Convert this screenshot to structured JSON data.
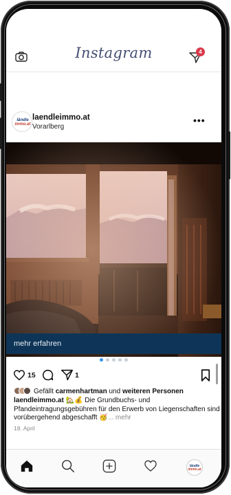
{
  "header": {
    "logo": "Instagram",
    "camera_icon": "camera-icon",
    "direct_icon": "direct-message-icon",
    "direct_badge": "4"
  },
  "post": {
    "username": "laendleimmo.at",
    "location": "Vorarlberg",
    "avatar_text_top": "ländle",
    "avatar_text_bottom": "immo.at",
    "more_label": "•••",
    "cta_label": "mehr erfahren",
    "carousel_total": 5,
    "carousel_active": 1,
    "likes_count": "15",
    "comments_count": "",
    "shares_count": "1",
    "liked_by_prefix": "Gefällt ",
    "liked_by_user": "carmenhartman",
    "liked_by_middle": " und ",
    "liked_by_rest": "weiteren Personen",
    "caption_user": "laendleimmo.at",
    "caption_emoji": " 🏡💰 ",
    "caption_text": "Die Grundbuchs- und Pfandeintragungsgebühren für den Erwerb von Liegenschaften sind vorübergehend abgeschafft 🥳",
    "caption_more": "... mehr",
    "date": "18. April"
  },
  "nav": {
    "items": [
      "home-icon",
      "search-icon",
      "new-post-icon",
      "activity-icon",
      "profile-avatar"
    ]
  },
  "colors": {
    "accent_blue": "#3897f0",
    "badge_red": "#d9394b",
    "cta_navy": "#0e3557",
    "logo_color": "#444e73"
  }
}
